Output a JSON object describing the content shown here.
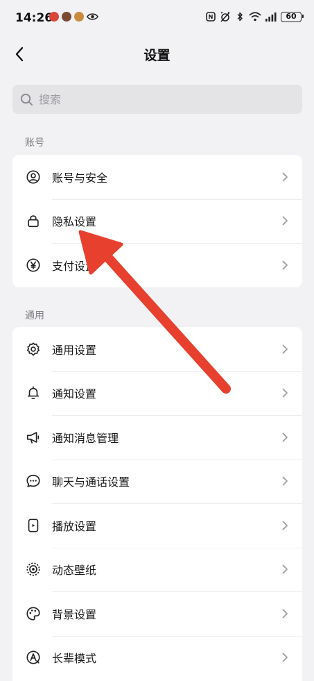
{
  "status_bar": {
    "time": "14:26",
    "battery": "60"
  },
  "header": {
    "title": "设置"
  },
  "search": {
    "placeholder": "搜索"
  },
  "sections": {
    "account": {
      "label": "账号",
      "items": [
        {
          "label": "账号与安全",
          "icon": "user-circle-icon"
        },
        {
          "label": "隐私设置",
          "icon": "lock-icon"
        },
        {
          "label": "支付设置",
          "icon": "yen-icon"
        }
      ]
    },
    "general": {
      "label": "通用",
      "items": [
        {
          "label": "通用设置",
          "icon": "gear-icon"
        },
        {
          "label": "通知设置",
          "icon": "bell-icon"
        },
        {
          "label": "通知消息管理",
          "icon": "megaphone-icon"
        },
        {
          "label": "聊天与通话设置",
          "icon": "chat-bubble-icon"
        },
        {
          "label": "播放设置",
          "icon": "play-device-icon"
        },
        {
          "label": "动态壁纸",
          "icon": "live-wallpaper-icon"
        },
        {
          "label": "背景设置",
          "icon": "palette-icon"
        },
        {
          "label": "长辈模式",
          "icon": "elder-mode-icon"
        }
      ]
    }
  },
  "annotation": {
    "arrow_color": "#e8402f"
  }
}
